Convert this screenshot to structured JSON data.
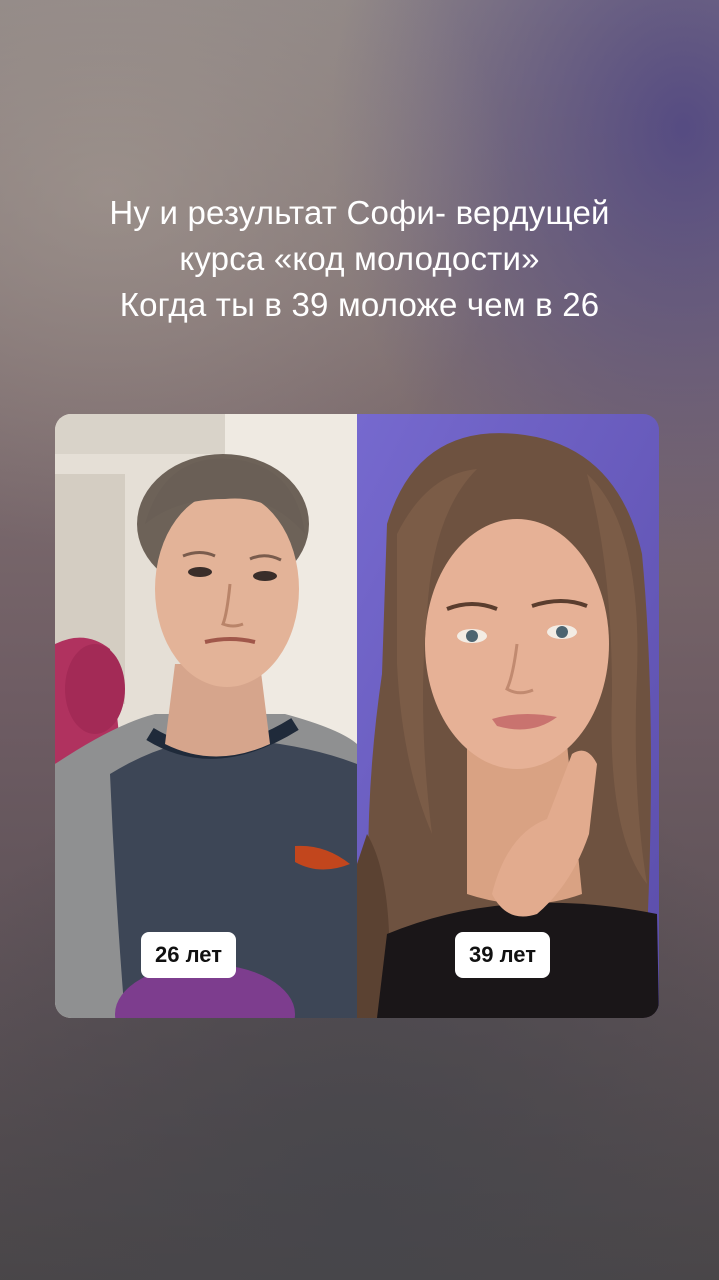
{
  "caption": {
    "line1": "Ну и результат Софи- вердущей",
    "line2": "курса «код молодости»",
    "line3": "Когда ты в 39 моложе чем в 26"
  },
  "collage": {
    "before_label": "26 лет",
    "after_label": "39 лет",
    "colors": {
      "before_background": "#e7e1d8",
      "after_background": "#6d5fc4"
    }
  }
}
